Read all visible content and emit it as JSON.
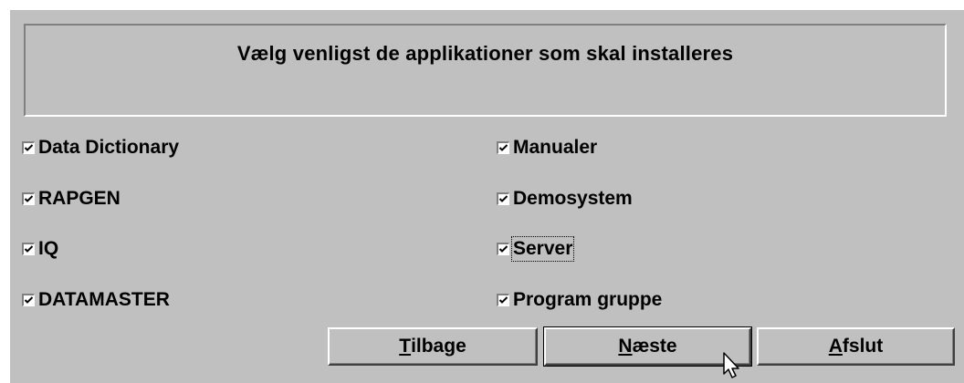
{
  "header": {
    "text": "Vælg venligst de applikationer som skal installeres"
  },
  "left_column": [
    {
      "label": "Data Dictionary",
      "checked": true
    },
    {
      "label": "RAPGEN",
      "checked": true
    },
    {
      "label": "IQ",
      "checked": true
    },
    {
      "label": "DATAMASTER",
      "checked": true
    }
  ],
  "right_column": [
    {
      "label": "Manualer",
      "checked": true
    },
    {
      "label": "Demosystem",
      "checked": true
    },
    {
      "label": "Server",
      "checked": true,
      "focused": true
    },
    {
      "label": "Program gruppe",
      "checked": true
    }
  ],
  "buttons": {
    "back": {
      "mnemonic": "T",
      "rest": "ilbage"
    },
    "next": {
      "mnemonic": "N",
      "rest": "æste"
    },
    "exit": {
      "mnemonic": "A",
      "rest": "fslut"
    }
  }
}
